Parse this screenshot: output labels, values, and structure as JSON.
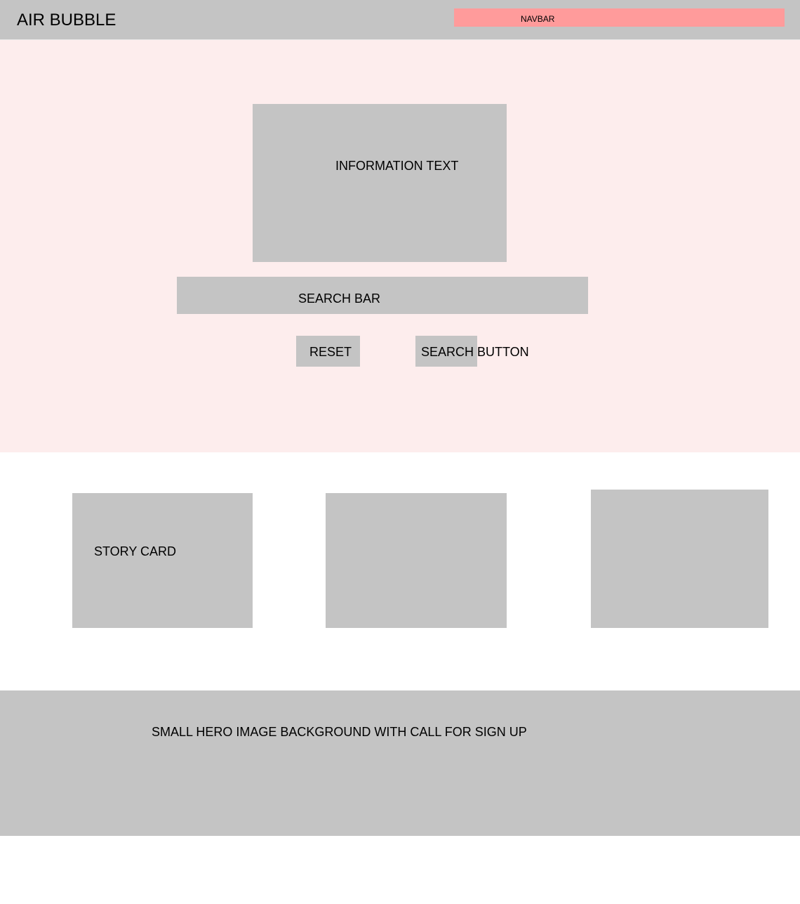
{
  "header": {
    "logo": "AIR BUBBLE",
    "navbar_label": "NAVBAR"
  },
  "hero": {
    "information_text": "INFORMATION TEXT",
    "search_bar_label": "SEARCH BAR",
    "reset_label": "RESET",
    "search_button_label": "SEARCH BUTTON"
  },
  "stories": {
    "card_label": "STORY CARD"
  },
  "signup": {
    "text": "SMALL HERO IMAGE BACKGROUND WITH CALL FOR SIGN UP"
  },
  "colors": {
    "placeholder": "#c4c4c4",
    "navbar": "#ff9b9b",
    "hero_bg": "#fdeded"
  }
}
